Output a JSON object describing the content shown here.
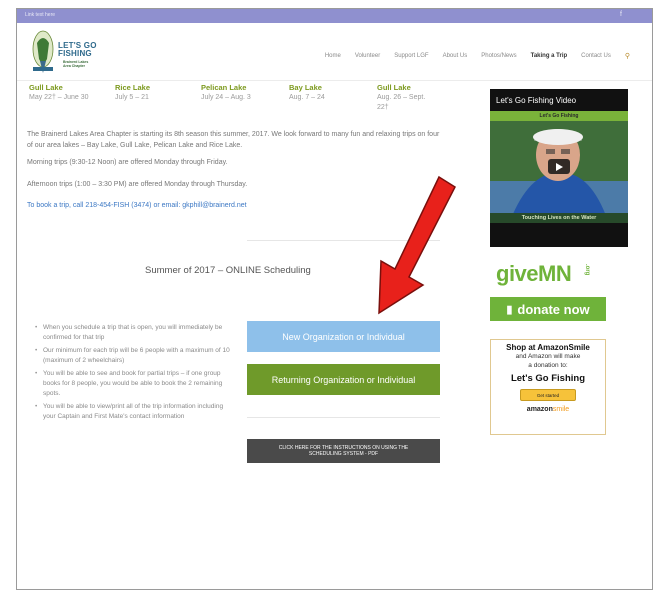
{
  "topbar": {
    "left_text": "Link text here",
    "right_text": "f"
  },
  "logo": {
    "title_line1": "LET'S GO",
    "title_line2": "FISHING",
    "sub_line1": "Brainerd Lakes",
    "sub_line2": "Area Chapter"
  },
  "nav": {
    "items": [
      "Home",
      "Volunteer",
      "Support LGF",
      "About Us",
      "Photos/News",
      "Taking a Trip",
      "Contact Us"
    ],
    "active_index": 5,
    "search_icon": "search-icon"
  },
  "lakes": [
    {
      "name": "Gull Lake",
      "dates": "May 22† – June 30"
    },
    {
      "name": "Rice Lake",
      "dates": "July 5 – 21"
    },
    {
      "name": "Pelican  Lake",
      "dates": "July 24 – Aug. 3"
    },
    {
      "name": "Bay  Lake",
      "dates": "Aug. 7 – 24"
    },
    {
      "name": "Gull Lake",
      "dates": "Aug. 26 – Sept. 22†"
    }
  ],
  "intro": {
    "p1": "The Brainerd Lakes Area Chapter is starting its 8th season this summer, 2017.  We look forward to many fun and relaxing trips on four of our area lakes – Bay Lake, Gull Lake, Pelican Lake and Rice Lake.",
    "p2": "Morning trips (9:30-12 Noon) are offered Monday through Friday.",
    "p3": "Afternoon trips (1:00 – 3:30 PM) are offered Monday through Thursday.",
    "p4": "To book a trip, call 218-454-FISH (3474) or email: gkphill@brainerd.net"
  },
  "scheduling": {
    "title": "Summer of 2017 – ONLINE Scheduling",
    "bullets": [
      "When you schedule a trip that is open, you will immediately be confirmed for that trip",
      "Our minimum for each trip will be 6 people with a maximum of 10 (maximum of 2 wheelchairs)",
      "You will be able to see and book for partial trips – if one group books for 8 people, you would be able to book the 2 remaining spots.",
      "You will be able to view/print all of the trip information including your Captain and First Mate's contact information"
    ],
    "btn_new": "New Organization or Individual",
    "btn_return": "Returning Organization or Individual",
    "btn_instructions": "CLICK HERE FOR THE INSTRUCTIONS ON USING THE SCHEDULING SYSTEM - PDF"
  },
  "sidebar": {
    "video_title": "Let's Go Fishing Video",
    "video_banner": "Let's Go Fishing",
    "video_footer": "Touching Lives on the Water",
    "givemn_logo": "giveMN",
    "givemn_org": ".org",
    "donate_label": "donate now",
    "smile_title": "Shop at AmazonSmile",
    "smile_line1": "and Amazon will make",
    "smile_line2": "a donation to:",
    "smile_org": "Let's Go Fishing",
    "smile_btn": "Get started",
    "smile_brand_a": "amazon",
    "smile_brand_b": "smile"
  },
  "colors": {
    "topbar": "#8f90cf",
    "lake_name": "#7d9a1f",
    "btn_new": "#8ec0ea",
    "btn_return": "#6f9a2a",
    "btn_instructions": "#4a4a4a",
    "arrow": "#e8211b",
    "givemn": "#6fb33a"
  }
}
